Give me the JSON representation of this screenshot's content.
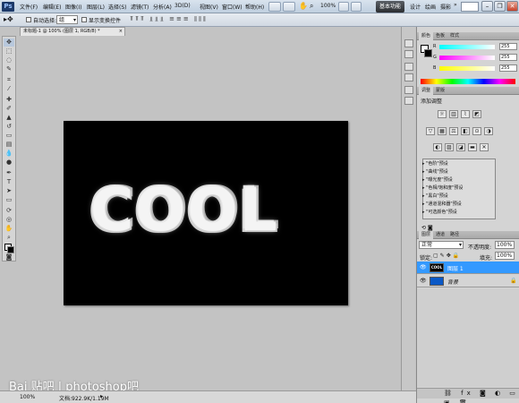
{
  "app": {
    "logo": "Ps"
  },
  "menubar": {
    "items": [
      "文件(F)",
      "编辑(E)",
      "图像(I)",
      "图层(L)",
      "选择(S)",
      "滤镜(T)",
      "分析(A)",
      "3D(D)",
      "视图(V)",
      "窗口(W)",
      "帮助(H)"
    ],
    "zoom": "100%",
    "workspace_active": "基本功能",
    "workspaces": [
      "设计",
      "绘画",
      "摄影"
    ]
  },
  "options": {
    "auto_select_label": "自动选择:",
    "auto_select_value": "组",
    "show_transform_label": "显示变换控件"
  },
  "document": {
    "tab_title": "未标题-1 @ 100% (图层 1, RGB/8) *",
    "text": "COOL",
    "background": "#000000"
  },
  "status": {
    "zoom": "100%",
    "doc_info": "文档:922.9K/1.19M"
  },
  "watermark": "Bai 贴吧 | photoshop吧",
  "color_panel": {
    "tabs": [
      "颜色",
      "色板",
      "样式"
    ],
    "channels": [
      {
        "label": "R",
        "value": "255",
        "color": "#ff0000"
      },
      {
        "label": "G",
        "value": "255",
        "color": "#00ff00"
      },
      {
        "label": "B",
        "value": "255",
        "color": "#0000ff"
      }
    ]
  },
  "adjust_panel": {
    "tabs": [
      "调整",
      "蒙版"
    ],
    "heading": "添加调整",
    "presets": [
      "\"色阶\"预设",
      "\"曲线\"预设",
      "\"曝光度\"预设",
      "\"色相/饱和度\"预设",
      "\"黑白\"预设",
      "\"通道混和器\"预设",
      "\"可选颜色\"预设"
    ]
  },
  "layers_panel": {
    "tabs": [
      "图层",
      "通道",
      "路径"
    ],
    "blend_mode": "正常",
    "opacity_label": "不透明度:",
    "opacity": "100%",
    "lock_label": "锁定:",
    "fill_label": "填充:",
    "fill": "100%",
    "layers": [
      {
        "name": "图层 1",
        "thumb_text": "COOL",
        "selected": true
      },
      {
        "name": "背景",
        "thumb_text": "",
        "selected": false
      }
    ]
  },
  "colors": {
    "accent": "#3399ff",
    "bg_layer_thumb": "#0a58c6"
  }
}
